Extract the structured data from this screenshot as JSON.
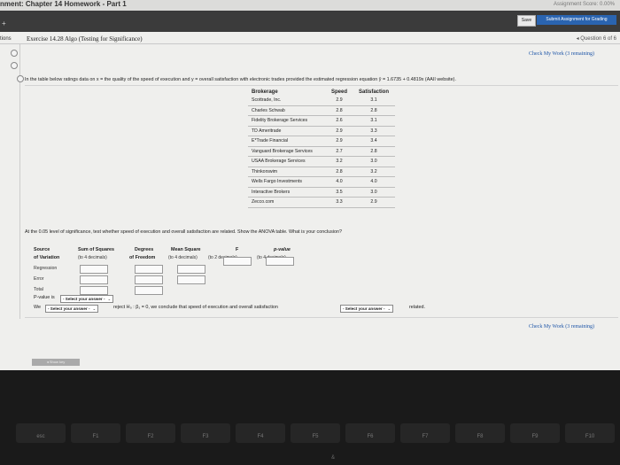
{
  "header": {
    "title": "nment: Chapter 14 Homework - Part 1",
    "score": "Assignment Score: 0.00%",
    "save_label": "Save",
    "submit_label": "Submit Assignment for Grading"
  },
  "exercise": {
    "side_label": "tions",
    "title": "Exercise 14.28 Algo (Testing for Significance)",
    "question_nav": "◂ Question 6 of 6",
    "check_work_top": "Check My Work (3 remaining)",
    "check_work_bottom": "Check My Work (3 remaining)"
  },
  "intro_text": "In the table below ratings data on x = the quality of the speed of execution and y = overall satisfaction with electronic trades provided the estimated regression equation ŷ = 1.6735 + 0.4819x (AAII website).",
  "table": {
    "headers": [
      "Brokerage",
      "Speed",
      "Satisfaction"
    ],
    "rows": [
      [
        "Scottrade, Inc.",
        "2.9",
        "3.1"
      ],
      [
        "Charles Schwab",
        "2.8",
        "2.8"
      ],
      [
        "Fidelity Brokerage Services",
        "2.6",
        "3.1"
      ],
      [
        "TD Ameritrade",
        "2.9",
        "3.3"
      ],
      [
        "E*Trade Financial",
        "2.9",
        "3.4"
      ],
      [
        "Vanguard Brokerage Services",
        "2.7",
        "2.8"
      ],
      [
        "USAA Brokerage Services",
        "3.2",
        "3.0"
      ],
      [
        "Thinkorswim",
        "2.8",
        "3.2"
      ],
      [
        "Wells Fargo Investments",
        "4.0",
        "4.0"
      ],
      [
        "Interactive Brokers",
        "3.5",
        "3.0"
      ],
      [
        "Zecco.com",
        "3.3",
        "2.9"
      ]
    ]
  },
  "question_text": "At the 0.05 level of significance, test whether speed of execution and overall satisfaction are related. Show the ANOVA table. What is your conclusion?",
  "anova": {
    "col_source": "Source",
    "col_source_sub": "of Variation",
    "col_ss": "Sum of Squares",
    "col_ss_sub": "(to 4 decimals)",
    "col_df": "Degrees",
    "col_df_sub": "of Freedom",
    "col_ms": "Mean Square",
    "col_ms_sub": "(to 4 decimals)",
    "col_f": "F",
    "col_f_sub": "(to 2 decimals)",
    "col_p": "p-value",
    "col_p_sub": "(to 4 decimals)",
    "rows": [
      "Regression",
      "Error",
      "Total"
    ]
  },
  "pvalue": {
    "label": "P-value is",
    "select": "- Select your answer -"
  },
  "conclusion": {
    "we": "We",
    "select1": "- Select your answer -",
    "middle": "reject H₀ : β₁ = 0, we conclude that speed of execution and overall satisfaction",
    "select2": "- Select your answer -",
    "end": "related."
  },
  "bottom_tab": "◂ Show key",
  "keyboard": {
    "fn_keys": [
      "esc",
      "F1",
      "F2",
      "F3",
      "F4",
      "F5",
      "F6",
      "F7",
      "F8",
      "F9",
      "F10"
    ],
    "letter": "&"
  }
}
